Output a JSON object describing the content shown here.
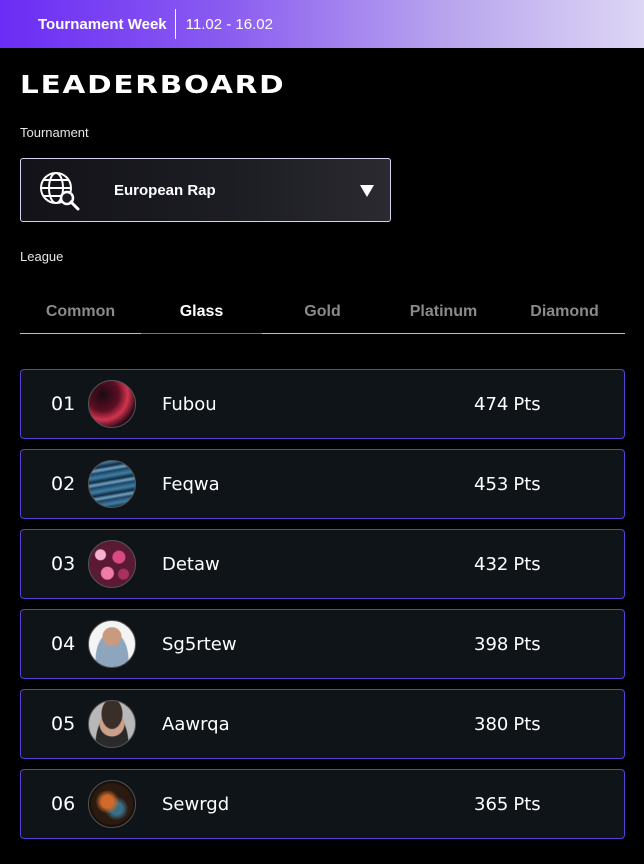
{
  "header": {
    "event": "Tournament Week",
    "dates": "11.02 - 16.02"
  },
  "page_title": "LEADERBOARD",
  "tournament": {
    "label": "Tournament",
    "selected": "European Rap",
    "icon": "globe-search-icon"
  },
  "league": {
    "label": "League",
    "tabs": [
      {
        "label": "Common"
      },
      {
        "label": "Glass"
      },
      {
        "label": "Gold"
      },
      {
        "label": "Platinum"
      },
      {
        "label": "Diamond"
      }
    ],
    "active": "Glass"
  },
  "leaderboard": [
    {
      "rank": "01",
      "name": "Fubou",
      "points": "474",
      "unit": "Pts"
    },
    {
      "rank": "02",
      "name": "Feqwa",
      "points": "453",
      "unit": "Pts"
    },
    {
      "rank": "03",
      "name": "Detaw",
      "points": "432",
      "unit": "Pts"
    },
    {
      "rank": "04",
      "name": "Sg5rtew",
      "points": "398",
      "unit": "Pts"
    },
    {
      "rank": "05",
      "name": "Aawrqa",
      "points": "380",
      "unit": "Pts"
    },
    {
      "rank": "06",
      "name": "Sewrgd",
      "points": "365",
      "unit": "Pts"
    }
  ],
  "colors": {
    "accent": "#6b2cf5",
    "row_border": "#5b3fd6",
    "row_bg": "#0f1419"
  }
}
